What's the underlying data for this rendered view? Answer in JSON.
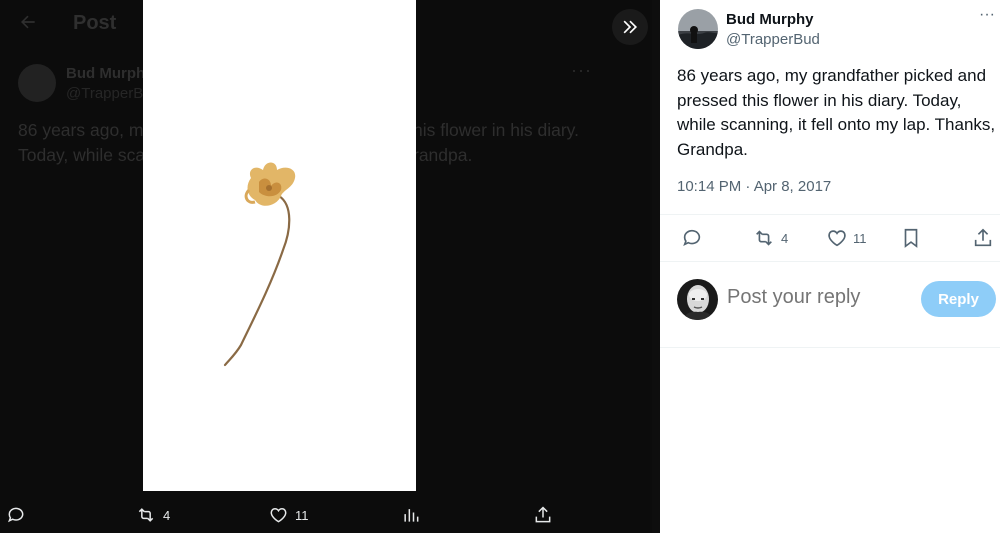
{
  "background_post": {
    "back_icon": "arrow-left-icon",
    "title": "Post",
    "author_name": "Bud Murph",
    "author_handle": "@TrapperB",
    "text_line1": "86 years ago, m",
    "text_line1_tail": "his flower in his diary.",
    "text_line2": "Today, while sca",
    "text_line2_tail": "randpa."
  },
  "viewer": {
    "collapse_icon": "chevrons-right-icon",
    "actions": {
      "reply_icon": "reply-icon",
      "retweet_count": "4",
      "like_count": "11",
      "views_icon": "analytics-icon",
      "share_icon": "share-icon"
    }
  },
  "tweet": {
    "author_name": "Bud Murphy",
    "author_handle": "@TrapperBud",
    "more_icon": "more-icon",
    "text": "86 years ago, my grandfather picked and pressed this flower in his diary. Today, while scanning, it fell onto my lap. Thanks, Grandpa.",
    "timestamp": "10:14 PM · Apr 8, 2017",
    "actions": {
      "reply_icon": "reply-icon",
      "retweet_count": "4",
      "like_count": "11",
      "bookmark_icon": "bookmark-icon",
      "share_icon": "share-icon"
    }
  },
  "reply": {
    "placeholder": "Post your reply",
    "button_label": "Reply",
    "button_color": "#8ecdf8"
  },
  "colors": {
    "text_primary": "#0f1419",
    "text_secondary": "#536471",
    "viewer_background": "#0c0c0c"
  }
}
